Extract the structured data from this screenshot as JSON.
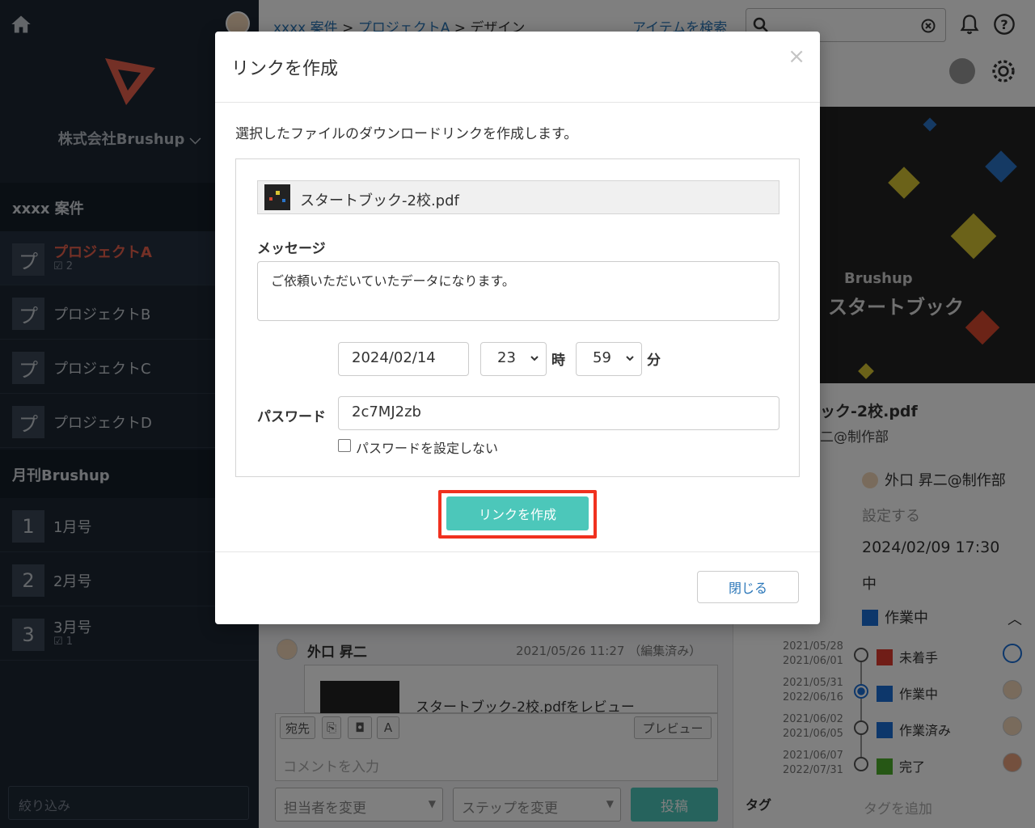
{
  "sidebar": {
    "company": "株式会社Brushup",
    "section1": "xxxx 案件",
    "projects": [
      {
        "badge": "プ",
        "label": "プロジェクトA",
        "count": "2"
      },
      {
        "badge": "プ",
        "label": "プロジェクトB"
      },
      {
        "badge": "プ",
        "label": "プロジェクトC"
      },
      {
        "badge": "プ",
        "label": "プロジェクトD"
      }
    ],
    "section2": "月刊Brushup",
    "issues": [
      {
        "badge": "1",
        "label": "1月号"
      },
      {
        "badge": "2",
        "label": "2月号"
      },
      {
        "badge": "3",
        "label": "3月号",
        "count": "1"
      }
    ],
    "filter_placeholder": "絞り込み"
  },
  "header": {
    "crumb1": "xxxx 案件",
    "sep": ">",
    "crumb2": "プロジェクトA",
    "crumb3": "デザイン",
    "search_link": "アイテムを検索"
  },
  "right": {
    "preview_brand": "Brushup",
    "preview_title": "スタートブック",
    "file_title": "ック-2校.pdf",
    "file_owner": "二@制作部",
    "assignee": "外口 昇二@制作部",
    "set_label": "設定する",
    "datetime": "2024/02/09 17:30",
    "priority": "中",
    "status": "作業中",
    "history": [
      {
        "d1": "2021/05/28",
        "d2": "2021/06/01",
        "label": "未着手",
        "color": "#e03a2f"
      },
      {
        "d1": "2021/05/31",
        "d2": "2022/06/16",
        "label": "作業中",
        "color": "#1a6fd6"
      },
      {
        "d1": "2021/06/02",
        "d2": "2021/06/05",
        "label": "作業済み",
        "color": "#1a6fd6"
      },
      {
        "d1": "2021/06/07",
        "d2": "2022/07/31",
        "label": "完了",
        "color": "#4caf2a"
      }
    ],
    "tag_label": "タグ",
    "tag_add": "タグを追加"
  },
  "comment": {
    "author": "外口 昇二",
    "time": "2021/05/26 11:27 （編集済み）",
    "review_text": "スタートブック-2校.pdfをレビュー",
    "btn_to": "宛先",
    "btn_preview": "プレビュー",
    "btn_font": "A",
    "input_placeholder": "コメントを入力",
    "assignee_select": "担当者を変更",
    "step_select": "ステップを変更",
    "post": "投稿"
  },
  "modal": {
    "title": "リンクを作成",
    "close_glyph": "×",
    "description": "選択したファイルのダウンロードリンクを作成します。",
    "file_name": "スタートブック-2校.pdf",
    "message_label": "メッセージ",
    "message_value": "ご依頼いただいていたデータになります。",
    "date_value": "2024/02/14",
    "hour_value": "23",
    "hour_unit": "時",
    "minute_value": "59",
    "minute_unit": "分",
    "password_label": "パスワード",
    "password_value": "2c7MJ2zb",
    "no_password_label": "パスワードを設定しない",
    "create_button": "リンクを作成",
    "close_button": "閉じる",
    "highlight_color": "#f0311f",
    "accent_color": "#4cc7ba"
  }
}
